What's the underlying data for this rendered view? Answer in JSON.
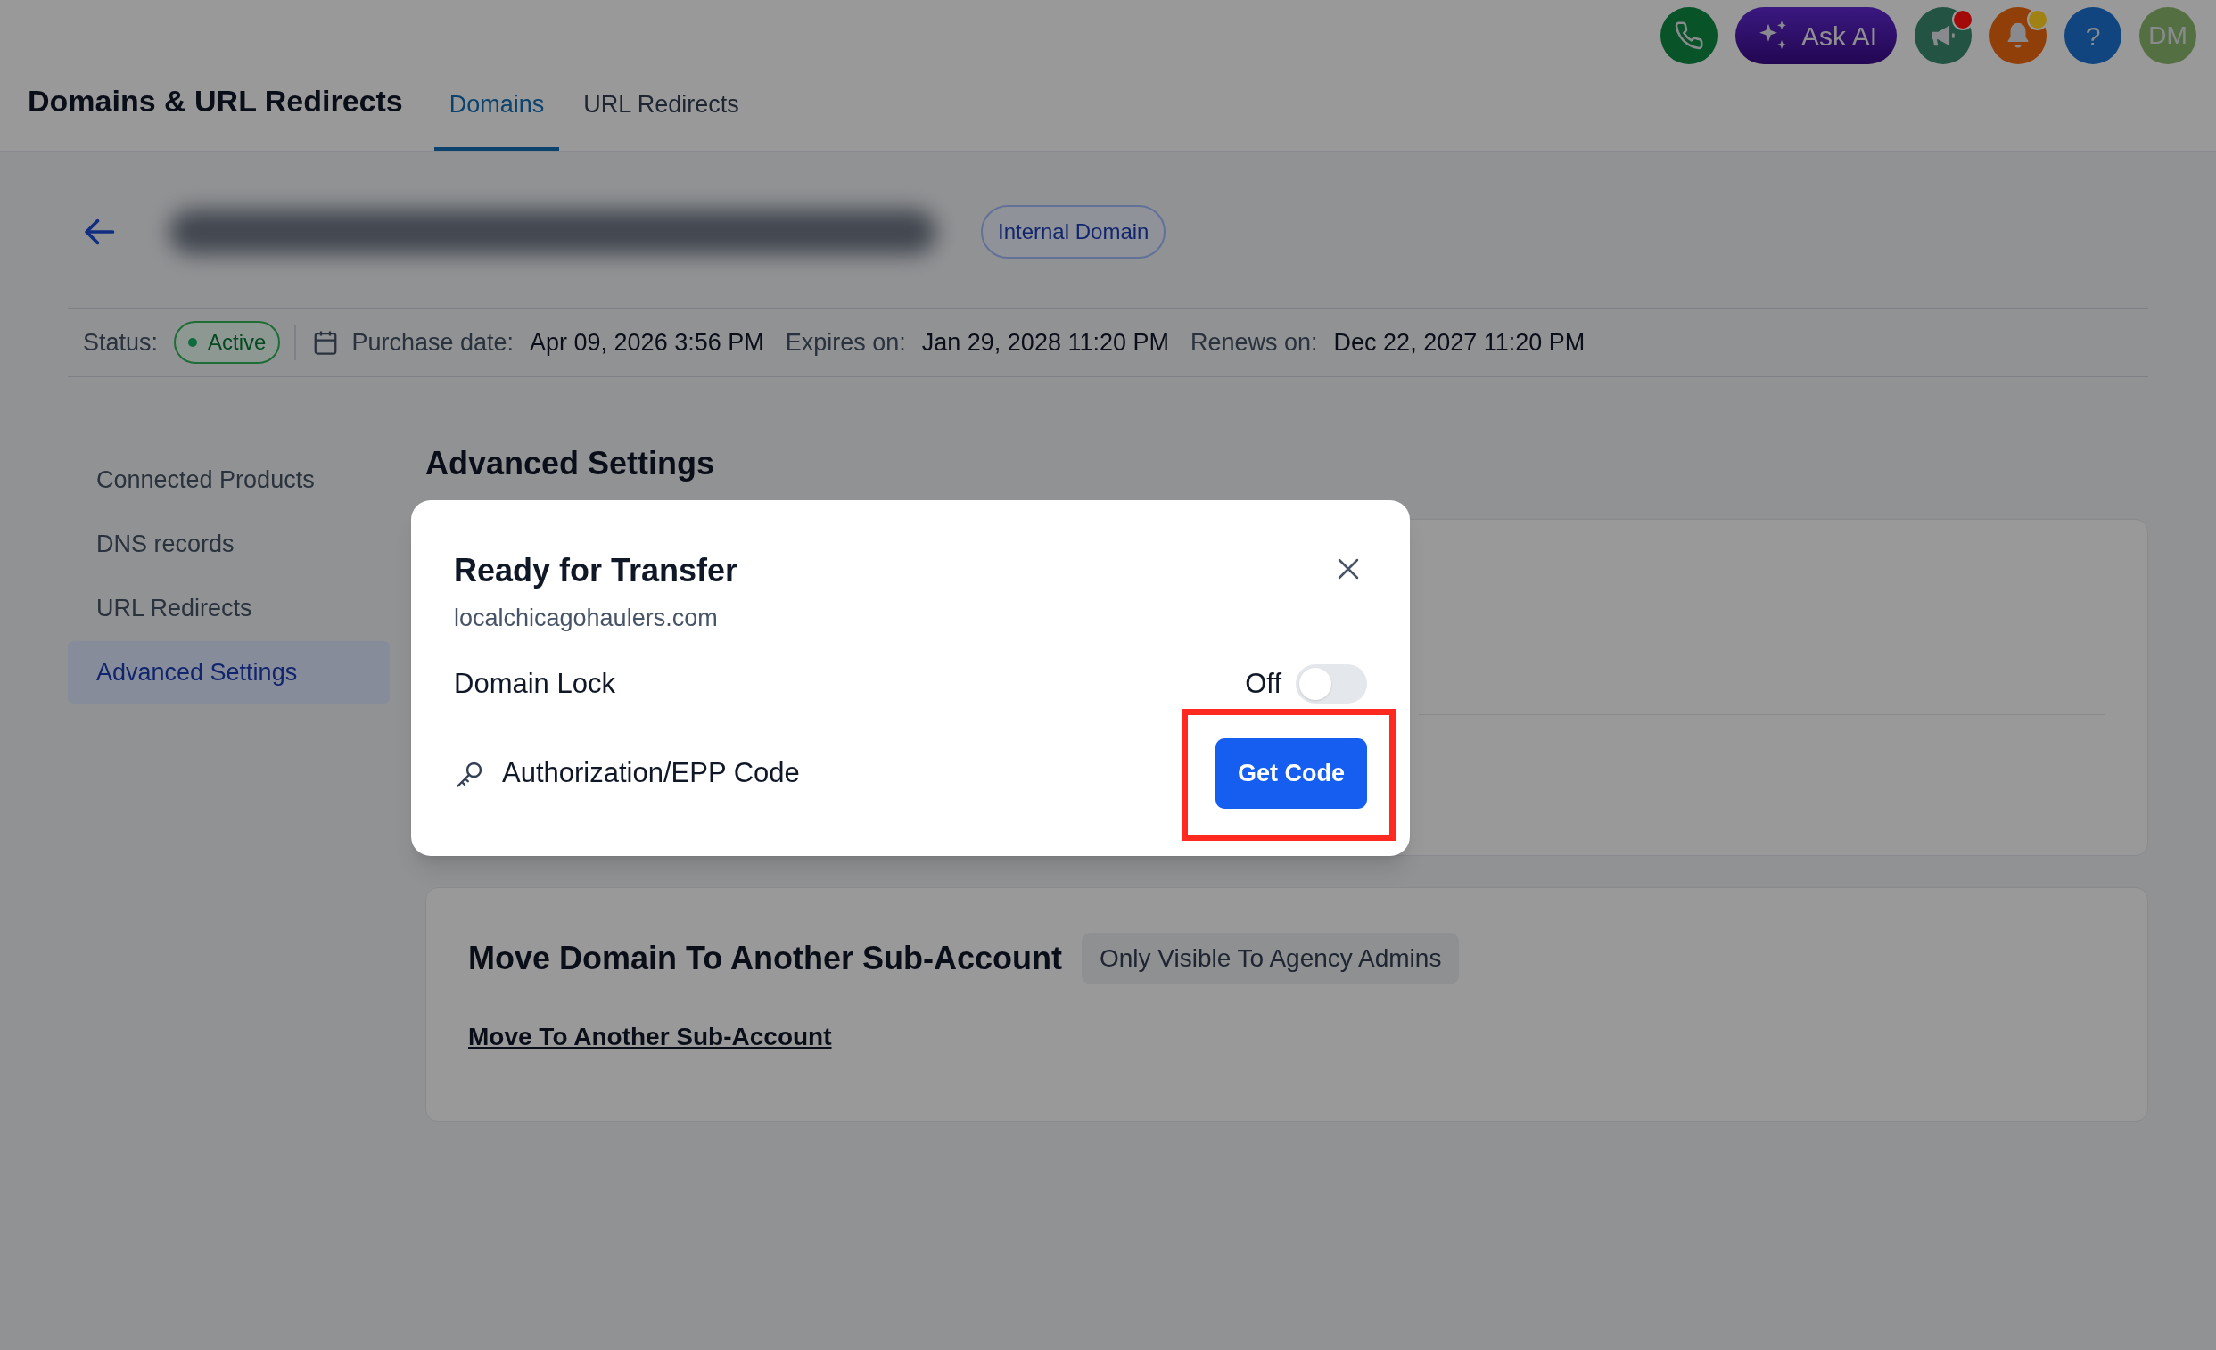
{
  "header": {
    "title": "Domains & URL Redirects",
    "tabs": [
      {
        "label": "Domains",
        "selected": true
      },
      {
        "label": "URL Redirects",
        "selected": false
      }
    ]
  },
  "top_actions": [
    {
      "kind": "phone"
    },
    {
      "kind": "ask_ai",
      "label": "Ask AI"
    },
    {
      "kind": "megaphone",
      "color": "#a30a0a"
    },
    {
      "kind": "bell",
      "color": "#a08214"
    },
    {
      "kind": "help",
      "label": "?"
    },
    {
      "kind": "avatar",
      "label": "DM"
    }
  ],
  "domain": {
    "badge": "Internal Domain",
    "status_label": "Status:",
    "status": "Active",
    "purchase_label": "Purchase date:",
    "purchase_date": "Apr 09, 2026 3:56 PM",
    "expires_label": "Expires on:",
    "expires": "Jan 29, 2028 11:20 PM",
    "renews_label": "Renews on:",
    "renews": "Dec 22, 2027 11:20 PM"
  },
  "sidebar": {
    "items": [
      {
        "label": "Connected Products",
        "selected": false
      },
      {
        "label": "DNS records",
        "selected": false
      },
      {
        "label": "URL Redirects",
        "selected": false
      },
      {
        "label": "Advanced Settings",
        "selected": true
      }
    ]
  },
  "section_title": "Advanced Settings",
  "move_card": {
    "title": "Move Domain To Another Sub-Account",
    "badge": "Only Visible To Agency Admins",
    "link": "Move To Another Sub-Account"
  },
  "modal": {
    "title": "Ready for Transfer",
    "subtitle": "localchicagohaulers.com",
    "lock_label": "Domain Lock",
    "lock_state": "Off",
    "lock_on": false,
    "code_label": "Authorization/EPP Code",
    "button": "Get Code",
    "highlighted": true
  }
}
